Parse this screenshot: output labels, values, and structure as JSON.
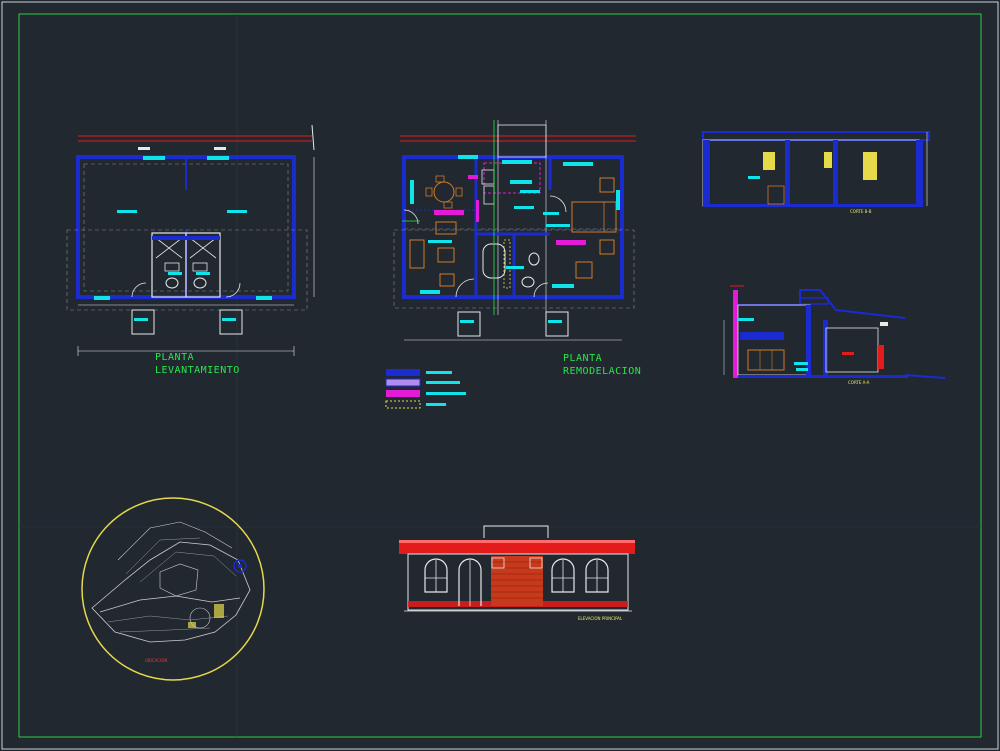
{
  "drawing": {
    "colors": {
      "background": "#212830",
      "frame_outer": "#c9d1d9",
      "frame_inner": "#2ecc40",
      "wall": "#1a2bd0",
      "cyan": "#11e3ea",
      "magenta": "#e31bd8",
      "red": "#e31b1b",
      "yellow": "#e6d94a",
      "white": "#e8e8e8",
      "orange": "#d27a2a"
    },
    "labels": {
      "plan_survey_line1": "PLANTA",
      "plan_survey_line2": "LEVANTAMIENTO",
      "plan_remodel_line1": "PLANTA",
      "plan_remodel_line2": "REMODELACION",
      "section_bb": "CORTE B-B",
      "section_aa": "CORTE A-A",
      "elevation": "ELEVACION PRINCIPAL",
      "location": "UBICACION"
    }
  }
}
